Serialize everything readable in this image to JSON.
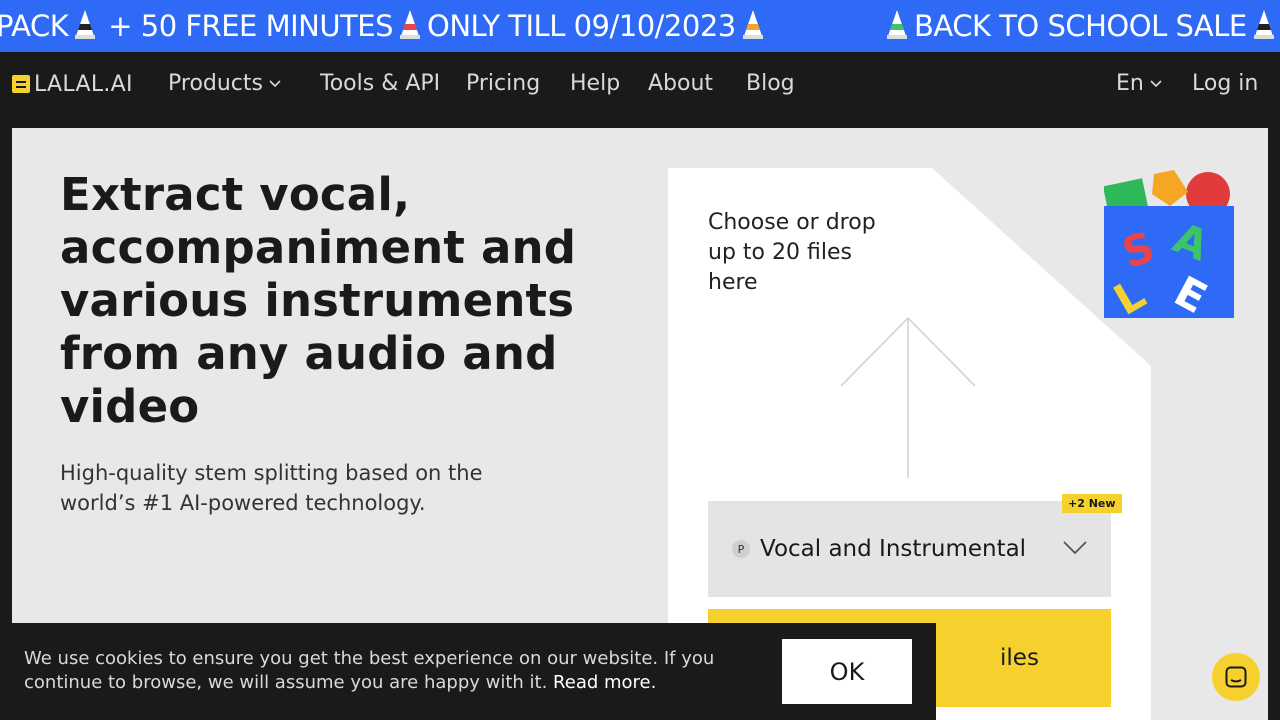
{
  "banner": {
    "segments": [
      "PACK",
      "+ 50 FREE MINUTES",
      "ONLY TILL 09/10/2023",
      "BACK TO SCHOOL SALE"
    ]
  },
  "nav": {
    "logo": "LALAL.AI",
    "items": [
      "Products",
      "Tools & API",
      "Pricing",
      "Help",
      "About",
      "Blog"
    ],
    "language": "En",
    "login": "Log in"
  },
  "hero": {
    "headline": "Extract vocal, accompaniment and various instruments from any audio and video",
    "subline": "High-quality stem splitting based on the world’s #1 AI-powered technology."
  },
  "upload": {
    "drop_text": "Choose or drop up to 20 files here",
    "badge": "+2 New",
    "stem_icon": "P",
    "stem_selected": "Vocal and Instrumental",
    "select_files_visible": "iles"
  },
  "cookie": {
    "text": "We use cookies to ensure you get the best experience on our website. If you continue to browse, we will assume you are happy with it.",
    "link": "Read more.",
    "ok": "OK"
  },
  "colors": {
    "banner_bg": "#2e6af5",
    "accent_yellow": "#f6d12e",
    "dark_bg": "#1a1a1a",
    "panel_bg": "#e8e8e8"
  }
}
